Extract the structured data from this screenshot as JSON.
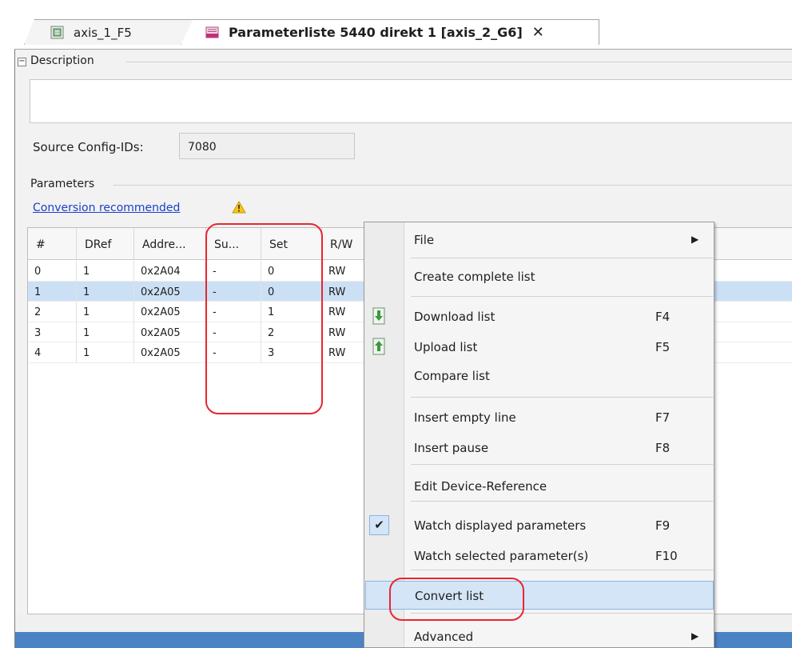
{
  "tabs": [
    {
      "label": "axis_1_F5",
      "icon": "config-icon"
    },
    {
      "label": "Parameterliste 5440 direkt 1 [axis_2_G6]",
      "icon": "parameter-list-icon",
      "close": "✕"
    }
  ],
  "description": {
    "title": "Description",
    "toggle": "−",
    "value": ""
  },
  "source": {
    "label": "Source Config-IDs:",
    "value": "7080"
  },
  "parameters": {
    "title": "Parameters",
    "conversion_link": "Conversion recommended",
    "warning_icon": "warning-icon"
  },
  "table": {
    "columns": [
      "#",
      "DRef",
      "Addre...",
      "Su...",
      "Set",
      "R/W"
    ],
    "rows": [
      [
        "0",
        "1",
        "0x2A04",
        "-",
        "0",
        "RW"
      ],
      [
        "1",
        "1",
        "0x2A05",
        "-",
        "0",
        "RW"
      ],
      [
        "2",
        "1",
        "0x2A05",
        "-",
        "1",
        "RW"
      ],
      [
        "3",
        "1",
        "0x2A05",
        "-",
        "2",
        "RW"
      ],
      [
        "4",
        "1",
        "0x2A05",
        "-",
        "3",
        "RW"
      ]
    ],
    "selected_row": 1
  },
  "context_menu": {
    "items": [
      {
        "label": "File",
        "key": "",
        "submenu": true
      },
      {
        "label": "Create complete list",
        "key": ""
      },
      {
        "label": "Download list",
        "key": "F4",
        "icon": "download-icon"
      },
      {
        "label": "Upload list",
        "key": "F5",
        "icon": "upload-icon"
      },
      {
        "label": "Compare list",
        "key": ""
      },
      {
        "label": "Insert empty line",
        "key": "F7"
      },
      {
        "label": "Insert pause",
        "key": "F8"
      },
      {
        "label": "Edit Device-Reference",
        "key": ""
      },
      {
        "label": "Watch displayed parameters",
        "key": "F9",
        "checked": true
      },
      {
        "label": "Watch selected parameter(s)",
        "key": "F10"
      },
      {
        "label": "Convert list",
        "key": "",
        "highlighted": true
      },
      {
        "label": "Advanced",
        "key": "",
        "submenu": true
      }
    ],
    "submenu_arrow": "▶",
    "check_mark": "✔"
  },
  "colors": {
    "highlight_outline": "#e8262f",
    "selection": "#cce0f5",
    "link": "#1a3fcb",
    "statusbar": "#4c83c4"
  }
}
